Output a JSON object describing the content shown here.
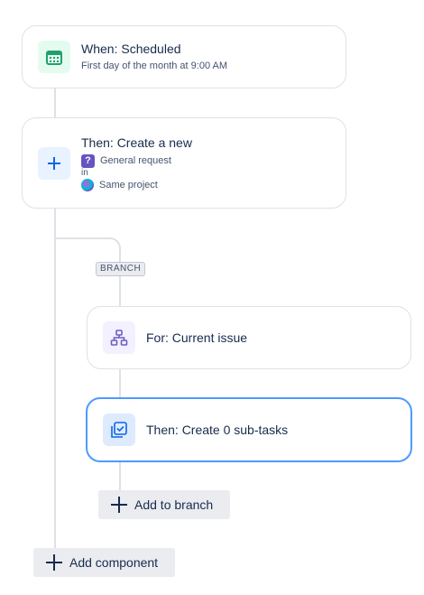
{
  "trigger": {
    "title": "When: Scheduled",
    "subtitle": "First day of the month at 9:00 AM",
    "icon": "calendar-icon"
  },
  "action_create": {
    "title": "Then: Create a new",
    "issue_type_icon": "?",
    "issue_type": "General request",
    "in_label": "in",
    "project": "Same project"
  },
  "branch": {
    "tag": "BRANCH",
    "for_card": {
      "title": "For: Current issue"
    },
    "subtask_card": {
      "title": "Then: Create 0 sub-tasks"
    },
    "add_to_branch_label": "Add to branch"
  },
  "add_component_label": "Add component",
  "colors": {
    "selected_border": "#4c9aff",
    "connector": "#dfe1e6",
    "calendar_green": "#22a06b",
    "plus_blue": "#0c66e4",
    "hierarchy_purple": "#6e5dc6"
  }
}
